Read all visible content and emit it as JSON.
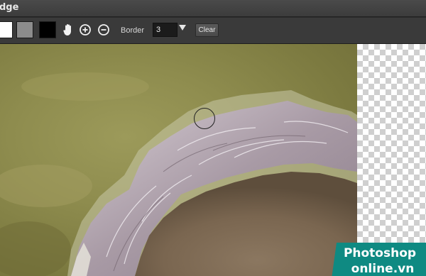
{
  "window": {
    "title": "dge"
  },
  "toolbar": {
    "swatches": [
      {
        "name": "white",
        "color": "#ffffff"
      },
      {
        "name": "gray",
        "color": "#8c8c8c"
      },
      {
        "name": "black",
        "color": "#000000"
      }
    ],
    "icons": [
      "hand-icon",
      "zoom-in-icon",
      "zoom-out-icon"
    ],
    "border_label": "Border",
    "border_value": "3",
    "clear_label": "Clear"
  },
  "watermark": {
    "line1": "Photoshop",
    "line2": "online.vn",
    "color": "#0f8a82"
  }
}
